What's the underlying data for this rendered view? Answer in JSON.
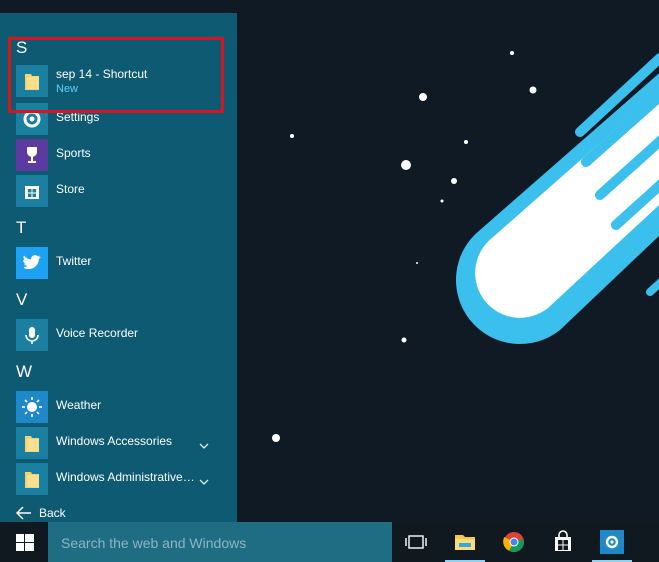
{
  "start_menu": {
    "sections": [
      {
        "letter": "S"
      },
      {
        "letter": "T"
      },
      {
        "letter": "V"
      },
      {
        "letter": "W"
      }
    ],
    "apps": {
      "shortcut": {
        "label": "sep 14 - Shortcut",
        "sublabel": "New",
        "icon": "folder-icon"
      },
      "settings": {
        "label": "Settings",
        "icon": "gear-icon"
      },
      "sports": {
        "label": "Sports",
        "icon": "trophy-icon"
      },
      "store": {
        "label": "Store",
        "icon": "store-bag-icon"
      },
      "twitter": {
        "label": "Twitter",
        "icon": "twitter-bird-icon"
      },
      "voice_recorder": {
        "label": "Voice Recorder",
        "icon": "microphone-icon"
      },
      "weather": {
        "label": "Weather",
        "icon": "sun-icon"
      },
      "windows_accessories": {
        "label": "Windows Accessories",
        "icon": "folder-icon"
      },
      "windows_admin": {
        "label": "Windows Administrative…",
        "icon": "folder-icon"
      }
    },
    "back_label": "Back"
  },
  "taskbar": {
    "search_placeholder": "Search the web and Windows",
    "items": [
      "task-view-icon",
      "file-explorer-icon",
      "chrome-icon",
      "store-bag-icon",
      "settings-gear-icon"
    ]
  },
  "colors": {
    "start_menu_bg": "#0d5a72",
    "highlight_border": "#d6151d",
    "accent_light": "#5fd0ff",
    "taskbar_bg": "#111920",
    "search_bg": "#1f6d83",
    "wallpaper_bg": "#0f1a24",
    "comet": "#3bc0ee"
  }
}
